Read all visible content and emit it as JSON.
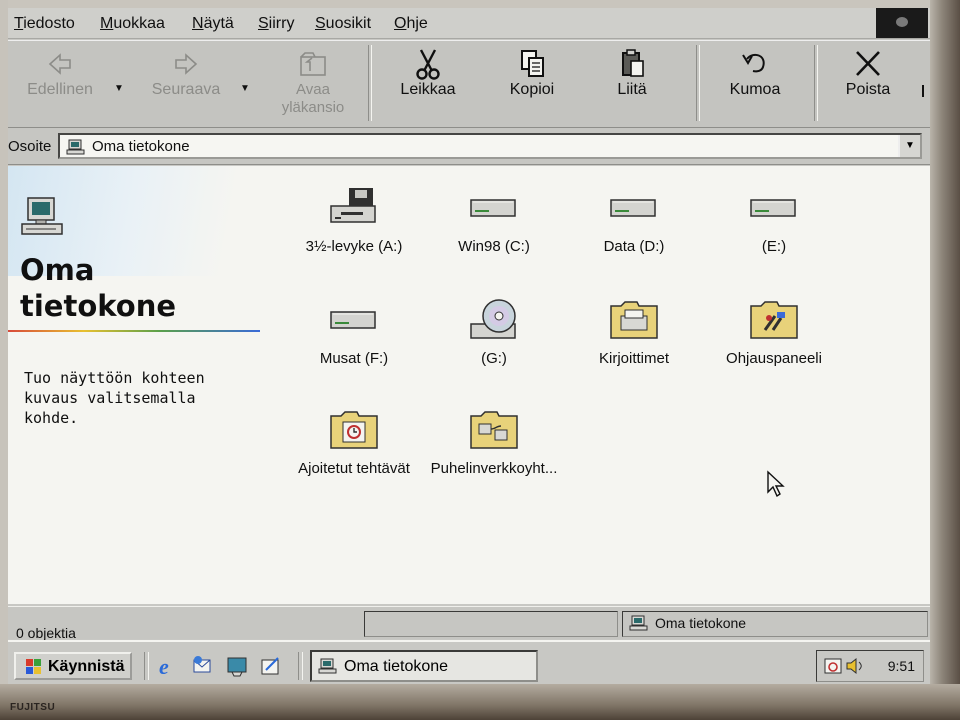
{
  "menu": {
    "items": [
      "Tiedosto",
      "Muokkaa",
      "Näytä",
      "Siirry",
      "Suosikit",
      "Ohje"
    ],
    "mnemonics": [
      "T",
      "M",
      "N",
      "S",
      "S",
      "O"
    ]
  },
  "toolbar": {
    "back": {
      "label": "Edellinen",
      "icon": "arrow-left-icon",
      "enabled": false
    },
    "forward": {
      "label": "Seuraava",
      "icon": "arrow-right-icon",
      "enabled": false
    },
    "up": {
      "label_line1": "Avaa",
      "label_line2": "yläkansio",
      "icon": "folder-up-icon",
      "enabled": false
    },
    "cut": {
      "label": "Leikkaa",
      "icon": "scissors-icon"
    },
    "copy": {
      "label": "Kopioi",
      "icon": "copy-icon"
    },
    "paste": {
      "label": "Liitä",
      "icon": "clipboard-icon"
    },
    "undo": {
      "label": "Kumoa",
      "icon": "undo-icon"
    },
    "delete": {
      "label": "Poista",
      "icon": "x-delete-icon"
    }
  },
  "address": {
    "label": "Osoite",
    "value": "Oma tietokone"
  },
  "left_pane": {
    "title_line1": "Oma",
    "title_line2": "tietokone",
    "description": "Tuo näyttöön kohteen kuvaus valitsemalla kohde."
  },
  "items": [
    {
      "label": "3½-levyke (A:)",
      "icon": "floppy-drive-icon"
    },
    {
      "label": "Win98 (C:)",
      "icon": "hard-drive-icon"
    },
    {
      "label": "Data (D:)",
      "icon": "hard-drive-icon"
    },
    {
      "label": "(E:)",
      "icon": "hard-drive-icon"
    },
    {
      "label": "Musat (F:)",
      "icon": "hard-drive-icon"
    },
    {
      "label": "(G:)",
      "icon": "cd-drive-icon"
    },
    {
      "label": "Kirjoittimet",
      "icon": "printers-folder-icon"
    },
    {
      "label": "Ohjauspaneeli",
      "icon": "control-panel-folder-icon"
    },
    {
      "label": "Ajoitetut tehtävät",
      "icon": "scheduled-tasks-folder-icon"
    },
    {
      "label": "Puhelinverkkoyht...",
      "icon": "dialup-folder-icon"
    }
  ],
  "status": {
    "left": "0 objektia",
    "right": "Oma tietokone"
  },
  "taskbar": {
    "start_label": "Käynnistä",
    "task_label": "Oma tietokone",
    "clock": "9:51"
  },
  "bezel": {
    "brand": "FUJITSU"
  },
  "colors": {
    "window_face": "#c6c6c2",
    "content_bg": "#f5f5f1",
    "text": "#101010",
    "disabled_text": "#8c8c88"
  }
}
